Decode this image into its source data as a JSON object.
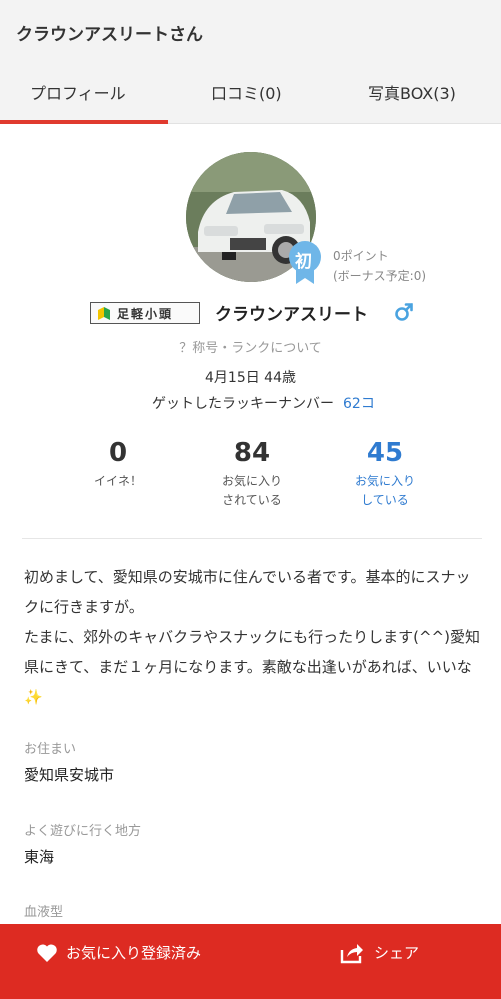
{
  "header": {
    "title": "クラウンアスリートさん"
  },
  "tabs": [
    {
      "label": "プロフィール"
    },
    {
      "label": "口コミ(0)"
    },
    {
      "label": "写真BOX(3)"
    }
  ],
  "profile": {
    "badge_char": "初",
    "points": "0ポイント",
    "bonus": "(ボーナス予定:0)",
    "title_plate": "足軽小頭",
    "name": "クラウンアスリート",
    "gender_symbol": "♂",
    "rank_link": "？称号・ランクについて",
    "birthday": "4月15日 44歳",
    "lucky_label": "ゲットしたラッキーナンバー",
    "lucky_value": "62コ"
  },
  "stats": [
    {
      "value": "0",
      "label_line1": "イイネ！",
      "label_line2": ""
    },
    {
      "value": "84",
      "label_line1": "お気に入り",
      "label_line2": "されている"
    },
    {
      "value": "45",
      "label_line1": "お気に入り",
      "label_line2": "している"
    }
  ],
  "bio": "初めまして、愛知県の安城市に住んでいる者です。基本的にスナックに行きますが。\nたまに、郊外のキャバクラやスナックにも行ったりします(^^)愛知県にきて、まだ１ヶ月になります。素敵な出逢いがあれば、いいな✨",
  "fields": [
    {
      "label": "お住まい",
      "value": "愛知県安城市"
    },
    {
      "label": "よく遊びに行く地方",
      "value": "東海"
    },
    {
      "label": "血液型",
      "value": ""
    }
  ],
  "bottom_bar": {
    "favorite_label": "お気に入り登録済み",
    "share_label": "シェア"
  },
  "colors": {
    "accent_red": "#dd2b22",
    "tab_underline": "#e03a2e",
    "link_blue": "#2f7bd0",
    "badge_blue": "#6fb6e8"
  },
  "icons": [
    "heart-icon",
    "share-icon",
    "male-icon",
    "beginner-mark-icon",
    "rank-ribbon-icon"
  ]
}
